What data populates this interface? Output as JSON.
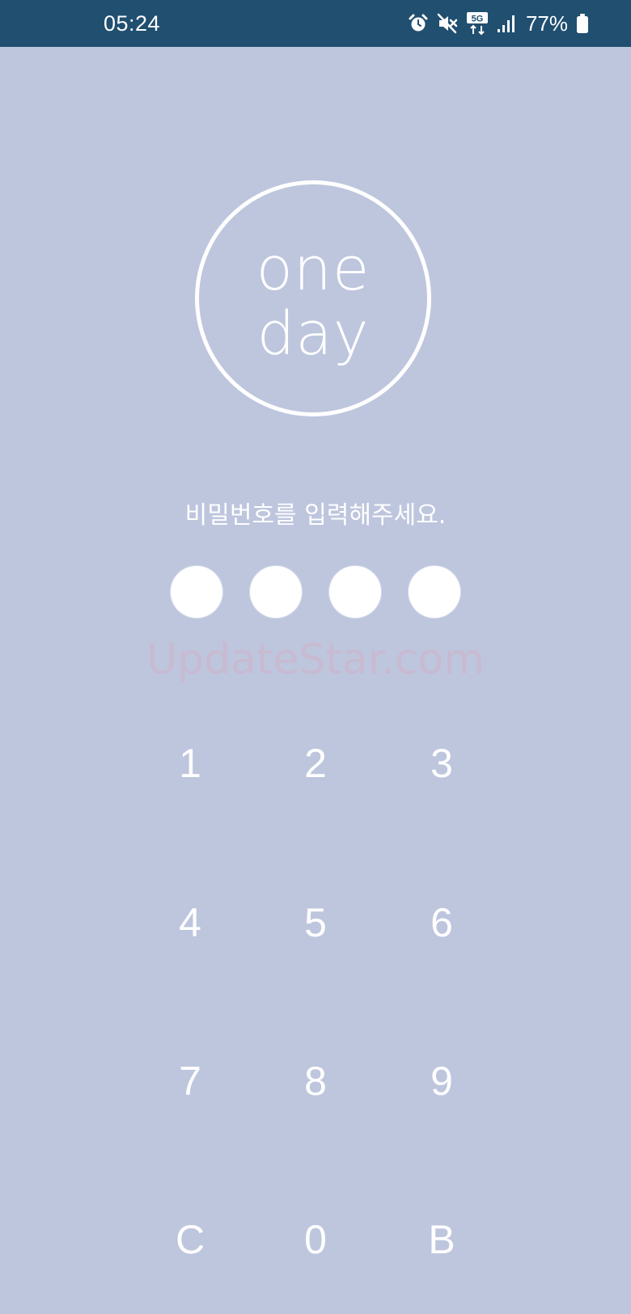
{
  "status_bar": {
    "time": "05:24",
    "icons": [
      "alarm-icon",
      "mute-icon",
      "5g-icon",
      "signal-icon"
    ],
    "battery_percent": "77%"
  },
  "logo": {
    "line1": "one",
    "line2": "day"
  },
  "prompt": "비밀번호를 입력해주세요.",
  "pin_dot_count": 4,
  "watermark": "UpdateStar.com",
  "keypad": {
    "k1": "1",
    "k2": "2",
    "k3": "3",
    "k4": "4",
    "k5": "5",
    "k6": "6",
    "k7": "7",
    "k8": "8",
    "k9": "9",
    "clear": "C",
    "k0": "0",
    "back": "B"
  },
  "colors": {
    "background": "#bec6de",
    "status_bar": "#204f70",
    "foreground": "#ffffff"
  }
}
